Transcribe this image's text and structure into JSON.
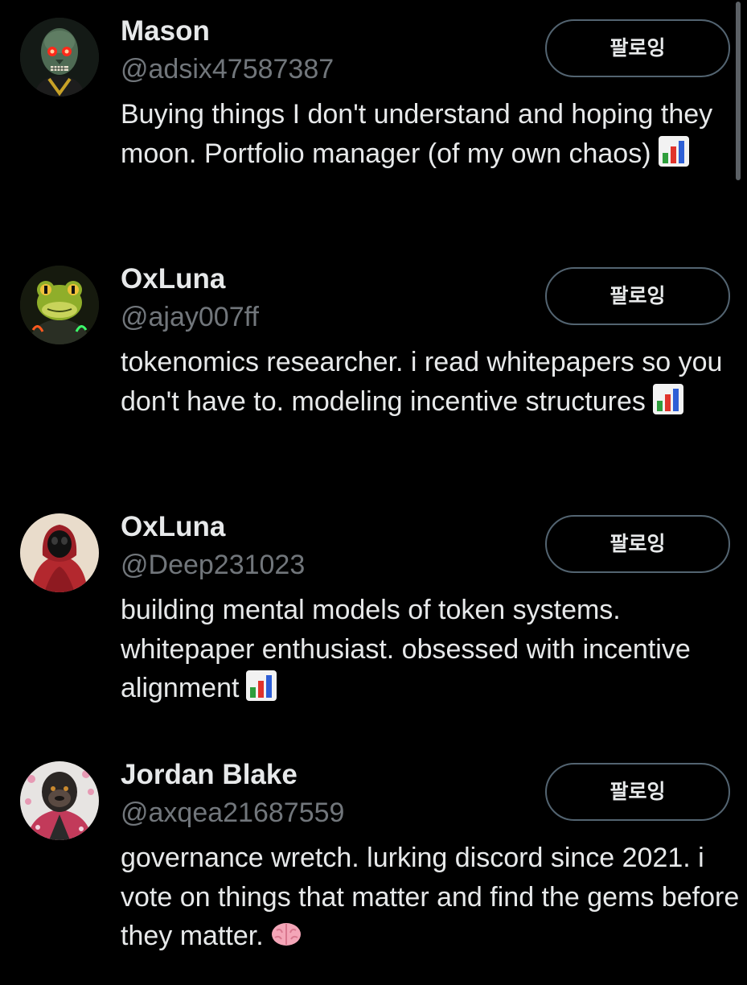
{
  "users": [
    {
      "name": "Mason",
      "handle": "@adsix47587387",
      "bio": "Buying things I don't understand and hoping they moon. Portfolio manager (of my own chaos)",
      "emoji": "bar-chart-emoji",
      "follow_label": "팔로잉",
      "avatar": "zombie-skull-avatar"
    },
    {
      "name": "OxLuna",
      "handle": "@ajay007ff",
      "bio": "tokenomics researcher. i read whitepapers so you don't have to. modeling incentive structures",
      "emoji": "bar-chart-emoji",
      "follow_label": "팔로잉",
      "avatar": "frog-avatar"
    },
    {
      "name": "OxLuna",
      "handle": "@Deep231023",
      "bio": "building mental models of token systems. whitepaper enthusiast. obsessed with incentive alignment",
      "emoji": "bar-chart-emoji",
      "follow_label": "팔로잉",
      "avatar": "hooded-figure-avatar"
    },
    {
      "name": "Jordan Blake",
      "handle": "@axqea21687559",
      "bio": "governance wretch. lurking discord since 2021. i vote on things that matter and find the gems before they matter.",
      "emoji": "brain-emoji",
      "follow_label": "팔로잉",
      "avatar": "gorilla-avatar"
    }
  ],
  "colors": {
    "background": "#000000",
    "primary_text": "#e7e9ea",
    "secondary_text": "#71767b",
    "button_border": "#536471"
  }
}
